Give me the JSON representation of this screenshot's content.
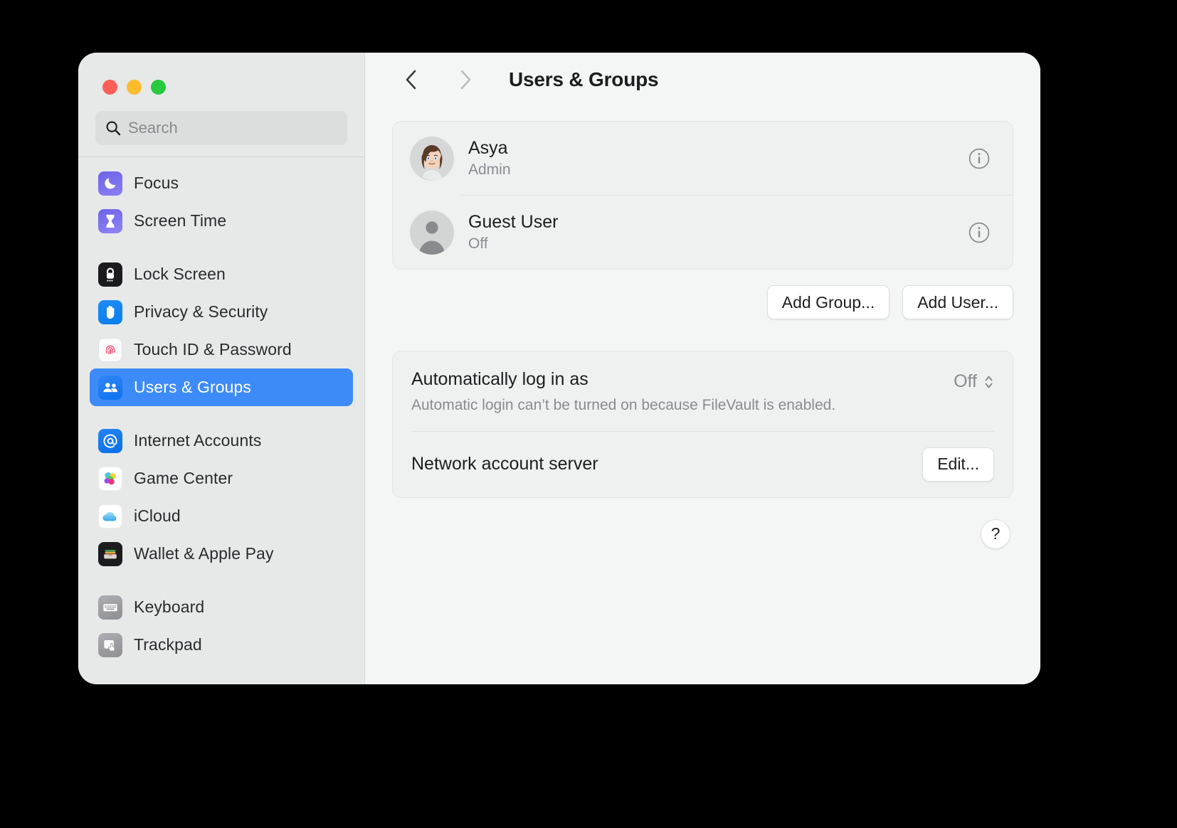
{
  "window": {
    "traffic_lights": [
      {
        "name": "close",
        "color": "#fc5f57"
      },
      {
        "name": "minimize",
        "color": "#fdbc2e"
      },
      {
        "name": "maximize",
        "color": "#28c83f"
      }
    ]
  },
  "sidebar": {
    "search": {
      "value": "",
      "placeholder": "Search"
    },
    "groups": [
      {
        "items": [
          {
            "label": "Focus",
            "icon": "moon-icon",
            "selected": false
          },
          {
            "label": "Screen Time",
            "icon": "hourglass-icon",
            "selected": false
          }
        ]
      },
      {
        "items": [
          {
            "label": "Lock Screen",
            "icon": "lock-icon",
            "selected": false
          },
          {
            "label": "Privacy & Security",
            "icon": "hand-icon",
            "selected": false
          },
          {
            "label": "Touch ID & Password",
            "icon": "fingerprint-icon",
            "selected": false
          },
          {
            "label": "Users & Groups",
            "icon": "people-icon",
            "selected": true
          }
        ]
      },
      {
        "items": [
          {
            "label": "Internet Accounts",
            "icon": "at-sign-icon",
            "selected": false
          },
          {
            "label": "Game Center",
            "icon": "game-center-icon",
            "selected": false
          },
          {
            "label": "iCloud",
            "icon": "cloud-icon",
            "selected": false
          },
          {
            "label": "Wallet & Apple Pay",
            "icon": "wallet-icon",
            "selected": false
          }
        ]
      },
      {
        "items": [
          {
            "label": "Keyboard",
            "icon": "keyboard-icon",
            "selected": false
          },
          {
            "label": "Trackpad",
            "icon": "trackpad-icon",
            "selected": false
          }
        ]
      }
    ]
  },
  "toolbar": {
    "back_enabled": true,
    "forward_enabled": false,
    "title": "Users & Groups"
  },
  "users": [
    {
      "name": "Asya",
      "status": "Admin",
      "avatar": "memoji-avatar"
    },
    {
      "name": "Guest User",
      "status": "Off",
      "avatar": "person-placeholder-avatar"
    }
  ],
  "actions": {
    "add_group": "Add Group...",
    "add_user": "Add User..."
  },
  "settings": {
    "auto_login": {
      "title": "Automatically log in as",
      "description": "Automatic login can’t be turned on because FileVault is enabled.",
      "value": "Off"
    },
    "network_account_server": {
      "title": "Network account server",
      "button": "Edit..."
    }
  },
  "help": {
    "label": "?"
  },
  "colors": {
    "accent": "#3d8bf8",
    "sidebar_bg": "#e7e9e9",
    "content_bg": "#f4f5f5",
    "card_bg": "#eff0f0"
  }
}
